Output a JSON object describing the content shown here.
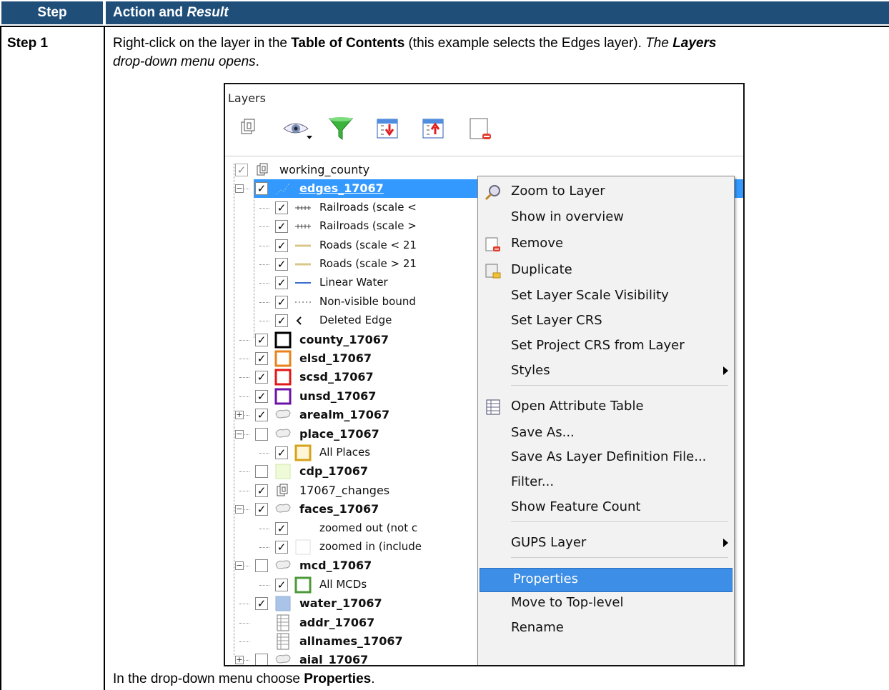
{
  "table": {
    "col_step": "Step",
    "col_action_plain": "Action and ",
    "col_action_em": "Result",
    "step_label": "Step 1",
    "intro": {
      "p1": "Right-click on the layer in the ",
      "b1": "Table of Contents",
      "p2": " (this example selects the Edges layer). ",
      "i1": "The ",
      "ib1": "Layers",
      "i2": " drop-down menu opens",
      "p3": "."
    },
    "footer": {
      "p1": "In the drop-down menu choose ",
      "b1": "Properties",
      "p2": "."
    }
  },
  "panel": {
    "title": "Layers",
    "toolbar_icons": [
      "add-group-icon",
      "eye-visibility-icon",
      "filter-funnel-icon",
      "expand-all-icon",
      "collapse-all-icon",
      "remove-layer-icon"
    ]
  },
  "tree": [
    {
      "label": "working_county",
      "checked": "grey",
      "expander": "-",
      "icon": "group-icon",
      "bold": false
    },
    {
      "label": "edges_17067",
      "checked": "on",
      "expander": "-",
      "icon": "line-icon",
      "bold": true,
      "selected": true
    },
    {
      "label": "Railroads (scale <",
      "checked": "on",
      "icon": "railroad-icon"
    },
    {
      "label": "Railroads (scale >",
      "checked": "on",
      "icon": "railroad-icon"
    },
    {
      "label": "Roads (scale < 21",
      "checked": "on",
      "icon": "road-icon"
    },
    {
      "label": "Roads (scale > 21",
      "checked": "on",
      "icon": "road-icon"
    },
    {
      "label": "Linear Water",
      "checked": "on",
      "icon": "water-line-icon"
    },
    {
      "label": "Non-visible bound",
      "checked": "on",
      "icon": "dashed-line-icon"
    },
    {
      "label": "Deleted Edge",
      "checked": "on",
      "icon": "deleted-icon"
    },
    {
      "label": "county_17067",
      "checked": "on",
      "icon": "box-black-icon",
      "bold": true
    },
    {
      "label": "elsd_17067",
      "checked": "on",
      "icon": "box-orange-icon",
      "bold": true
    },
    {
      "label": "scsd_17067",
      "checked": "on",
      "icon": "box-red-icon",
      "bold": true
    },
    {
      "label": "unsd_17067",
      "checked": "on",
      "icon": "box-purple-icon",
      "bold": true
    },
    {
      "label": "arealm_17067",
      "checked": "on",
      "expander": "+",
      "icon": "polygon-icon",
      "bold": true
    },
    {
      "label": "place_17067",
      "checked": "off",
      "expander": "-",
      "icon": "polygon-icon",
      "bold": true
    },
    {
      "label": "All Places",
      "checked": "on",
      "icon": "box-gold-icon"
    },
    {
      "label": "cdp_17067",
      "checked": "off",
      "icon": "box-lightgreen-icon",
      "bold": true
    },
    {
      "label": "17067_changes",
      "checked": "on",
      "icon": "group-icon"
    },
    {
      "label": "faces_17067",
      "checked": "on",
      "expander": "-",
      "icon": "polygon-icon",
      "bold": true
    },
    {
      "label": "zoomed out (not c",
      "checked": "on",
      "icon": "none"
    },
    {
      "label": "zoomed in (include",
      "checked": "on",
      "icon": "box-empty-icon"
    },
    {
      "label": "mcd_17067",
      "checked": "off",
      "expander": "-",
      "icon": "polygon-icon",
      "bold": true
    },
    {
      "label": "All MCDs",
      "checked": "on",
      "icon": "box-green-icon"
    },
    {
      "label": "water_17067",
      "checked": "on",
      "icon": "fill-blue-icon",
      "bold": true
    },
    {
      "label": "addr_17067",
      "checked": "none",
      "icon": "table-icon",
      "bold": true
    },
    {
      "label": "allnames_17067",
      "checked": "none",
      "icon": "table-icon",
      "bold": true
    },
    {
      "label": "aial_17067",
      "checked": "off",
      "expander": "+",
      "icon": "polygon-icon",
      "bold": true
    }
  ],
  "menu": {
    "items": [
      {
        "label": "Zoom to Layer",
        "icon": "zoom-icon"
      },
      {
        "label": "Show in overview"
      },
      {
        "label": "Remove",
        "icon": "remove-icon"
      },
      {
        "label": "Duplicate",
        "icon": "duplicate-icon"
      },
      {
        "label": "Set Layer Scale Visibility"
      },
      {
        "label": "Set Layer CRS"
      },
      {
        "label": "Set Project CRS from Layer"
      },
      {
        "label": "Styles",
        "submenu": true
      },
      {
        "label": "Open Attribute Table",
        "icon": "table-icon"
      },
      {
        "label": "Save As..."
      },
      {
        "label": "Save As Layer Definition File..."
      },
      {
        "label": "Filter..."
      },
      {
        "label": "Show Feature Count"
      },
      {
        "label": "GUPS Layer",
        "submenu": true
      },
      {
        "label": "Properties",
        "highlighted": true
      },
      {
        "label": "Move to Top-level"
      },
      {
        "label": "Rename"
      }
    ]
  },
  "colors": {
    "header_bg": "#1f4e79",
    "selection": "#3399ff",
    "menu_highlight": "#3d8ee6"
  }
}
